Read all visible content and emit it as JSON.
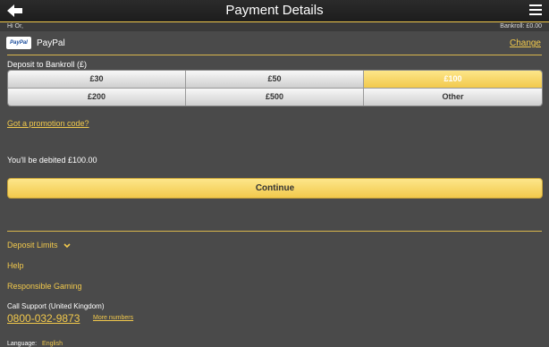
{
  "header": {
    "title": "Payment Details"
  },
  "subbar": {
    "greeting": "Hi Or,",
    "bankroll": "Bankroll: £0.00"
  },
  "method": {
    "logo_text": "PayPal",
    "label": "PayPal",
    "change": "Change"
  },
  "deposit": {
    "label": "Deposit to Bankroll (£)",
    "amounts": [
      "£30",
      "£50",
      "£100",
      "£200",
      "£500",
      "Other"
    ],
    "selected": "£100"
  },
  "promo": "Got a promotion code?",
  "debit_text": "You'll be debited £100.00",
  "continue_label": "Continue",
  "footer": {
    "deposit_limits": "Deposit Limits",
    "help": "Help",
    "responsible": "Responsible Gaming",
    "call_label": "Call Support (United Kingdom)",
    "phone": "0800-032-9873",
    "more_numbers": "More numbers",
    "language_label": "Language:",
    "language_value": "English"
  },
  "colors": {
    "accent": "#f2c94c",
    "background": "#4a4a4a",
    "topbar": "#222222"
  },
  "icons": {
    "back": "back-arrow-icon",
    "menu": "hamburger-menu-icon",
    "chevron": "chevron-down-icon"
  }
}
